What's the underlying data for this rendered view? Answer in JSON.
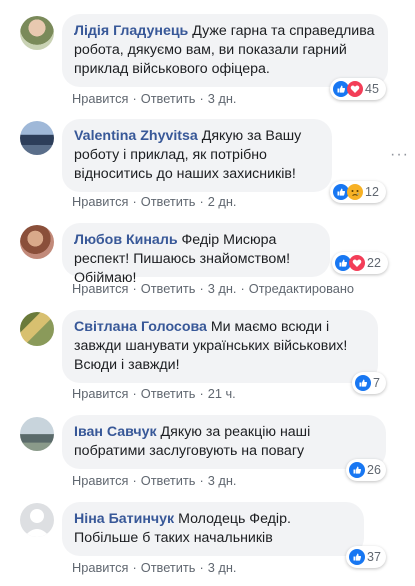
{
  "actions": {
    "like": "Нравится",
    "reply": "Ответить",
    "edited": "Отредактировано",
    "sep": "·"
  },
  "colors": {
    "link": "#385898",
    "bubble": "#f2f3f5",
    "meta": "#606770",
    "like_blue": "#1877f2",
    "love_red": "#f33e58"
  },
  "comments": [
    {
      "author": "Лідія Гладунець",
      "text": "Дуже гарна та справедлива робота, дякуємо вам, ви показали гарний приклад військового офіцера.",
      "time": "3 дн.",
      "reactions": [
        "like-icon",
        "love-icon"
      ],
      "reaction_count": "45"
    },
    {
      "author": "Valentina Zhyvitsa",
      "text": "Дякую за Вашу роботу і приклад, як потрібно відноситись до наших захисників!",
      "time": "2 дн.",
      "reactions": [
        "like-icon",
        "sad-icon"
      ],
      "reaction_count": "12",
      "more_menu": "···"
    },
    {
      "author": "Любов Киналь",
      "text": "Федір Мисюра респект! Пишаюсь знайомством! Обіймаю!",
      "time": "3 дн.",
      "edited": true,
      "reactions": [
        "like-icon",
        "love-icon"
      ],
      "reaction_count": "22"
    },
    {
      "author": "Світлана Голосова",
      "text": "Ми маємо всюди і завжди шанувати українських військових! Всюди і завжди!",
      "time": "21 ч.",
      "reactions": [
        "like-icon"
      ],
      "reaction_count": "7"
    },
    {
      "author": "Іван Савчук",
      "text": "Дякую за реакцію наші побратими заслуговують на повагу",
      "time": "3 дн.",
      "reactions": [
        "like-icon"
      ],
      "reaction_count": "26"
    },
    {
      "author": "Ніна Батинчук",
      "text": "Молодець Федір. Побільше б таких начальників",
      "time": "3 дн.",
      "reactions": [
        "like-icon"
      ],
      "reaction_count": "37"
    }
  ]
}
